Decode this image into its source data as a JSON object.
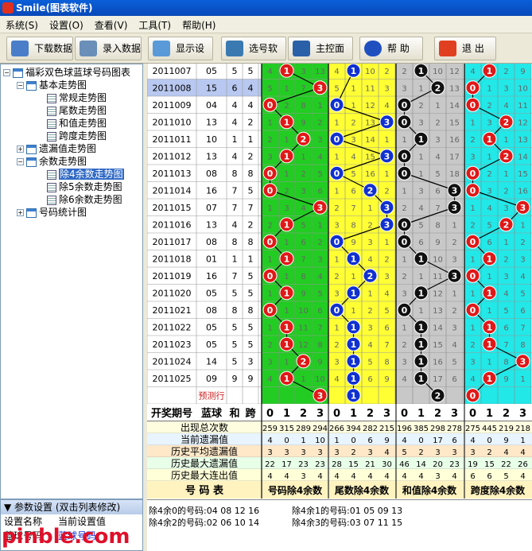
{
  "window": {
    "title": "Smile(图表软件)"
  },
  "menu": [
    "系统(S)",
    "设置(O)",
    "查看(V)",
    "工具(T)",
    "帮助(H)"
  ],
  "toolbar": {
    "download": "下载数据",
    "input": "录入数据",
    "display": "显示设置",
    "select": "选号软件",
    "panel": "主控面板",
    "help": "帮 助",
    "exit": "退 出"
  },
  "tree": {
    "root": "福彩双色球蓝球号码图表",
    "basic": "基本走势图",
    "normal": "常规走势图",
    "tail": "尾数走势图",
    "sum": "和值走势图",
    "span": "跨度走势图",
    "miss": "遗漏值走势图",
    "rem": "余数走势图",
    "mod4": "除4余数走势图",
    "mod5": "除5余数走势图",
    "mod6": "除6余数走势图",
    "stat": "号码统计图"
  },
  "params": {
    "header": "参数设置 (双击列表修改)",
    "col_name": "设置名称",
    "col_value": "当前设置值",
    "row_name": "蓝球号码",
    "row_value": "蓝球号码"
  },
  "watermark": "pinble.com",
  "rows": [
    {
      "p": "2011007",
      "n": "05",
      "t": "5",
      "s": "5",
      "a": [
        4,
        "@1",
        3,
        13
      ],
      "b": [
        4,
        "@1",
        10,
        2
      ],
      "c": [
        2,
        "@1",
        10,
        12
      ],
      "d": [
        4,
        "@1",
        2,
        9
      ]
    },
    {
      "p": "2011008",
      "n": "15",
      "t": "6",
      "s": "4",
      "a": [
        5,
        1,
        7,
        "@3"
      ],
      "b": [
        5,
        1,
        11,
        3
      ],
      "c": [
        3,
        1,
        "@2",
        13
      ],
      "d": [
        "@0",
        1,
        3,
        10
      ]
    },
    {
      "p": "2011009",
      "n": "04",
      "t": "4",
      "s": "4",
      "a": [
        "@0",
        2,
        8,
        1
      ],
      "b": [
        "@0",
        1,
        12,
        4
      ],
      "c": [
        "@0",
        2,
        1,
        14
      ],
      "d": [
        "@0",
        2,
        4,
        11
      ]
    },
    {
      "p": "2011010",
      "n": "13",
      "t": "4",
      "s": "2",
      "a": [
        1,
        "@1",
        9,
        2
      ],
      "b": [
        1,
        2,
        13,
        "@3"
      ],
      "c": [
        "@0",
        3,
        2,
        15
      ],
      "d": [
        1,
        3,
        "@2",
        12
      ]
    },
    {
      "p": "2011011",
      "n": "10",
      "t": "1",
      "s": "1",
      "a": [
        2,
        1,
        "@2",
        3
      ],
      "b": [
        "@0",
        3,
        14,
        1
      ],
      "c": [
        1,
        "@1",
        3,
        16
      ],
      "d": [
        2,
        "@1",
        1,
        13
      ]
    },
    {
      "p": "2011012",
      "n": "13",
      "t": "4",
      "s": "2",
      "a": [
        3,
        "@1",
        1,
        4
      ],
      "b": [
        1,
        4,
        15,
        "@3"
      ],
      "c": [
        "@0",
        1,
        4,
        17
      ],
      "d": [
        3,
        1,
        "@2",
        14
      ]
    },
    {
      "p": "2011013",
      "n": "08",
      "t": "8",
      "s": "8",
      "a": [
        "@0",
        1,
        2,
        5
      ],
      "b": [
        "@0",
        5,
        16,
        1
      ],
      "c": [
        "@0",
        1,
        5,
        18
      ],
      "d": [
        "@0",
        2,
        1,
        15
      ]
    },
    {
      "p": "2011014",
      "n": "16",
      "t": "7",
      "s": "5",
      "a": [
        "@0",
        2,
        3,
        6
      ],
      "b": [
        1,
        6,
        "@2",
        2
      ],
      "c": [
        1,
        3,
        6,
        "@3"
      ],
      "d": [
        "@0",
        3,
        2,
        16
      ]
    },
    {
      "p": "2011015",
      "n": "07",
      "t": "7",
      "s": "7",
      "a": [
        1,
        3,
        4,
        "@3"
      ],
      "b": [
        2,
        7,
        1,
        "@3"
      ],
      "c": [
        2,
        4,
        7,
        "@3"
      ],
      "d": [
        1,
        4,
        3,
        "@3"
      ]
    },
    {
      "p": "2011016",
      "n": "13",
      "t": "4",
      "s": "2",
      "a": [
        2,
        "@1",
        5,
        1
      ],
      "b": [
        3,
        8,
        2,
        "@3"
      ],
      "c": [
        "@0",
        5,
        8,
        1
      ],
      "d": [
        2,
        5,
        "@2",
        1
      ]
    },
    {
      "p": "2011017",
      "n": "08",
      "t": "8",
      "s": "8",
      "a": [
        "@0",
        1,
        6,
        2
      ],
      "b": [
        "@0",
        9,
        3,
        1
      ],
      "c": [
        "@0",
        6,
        9,
        2
      ],
      "d": [
        "@0",
        6,
        1,
        2
      ]
    },
    {
      "p": "2011018",
      "n": "01",
      "t": "1",
      "s": "1",
      "a": [
        1,
        "@1",
        7,
        3
      ],
      "b": [
        1,
        "@1",
        4,
        2
      ],
      "c": [
        1,
        "@1",
        10,
        3
      ],
      "d": [
        1,
        "@1",
        2,
        3
      ]
    },
    {
      "p": "2011019",
      "n": "16",
      "t": "7",
      "s": "5",
      "a": [
        "@0",
        1,
        8,
        4
      ],
      "b": [
        2,
        1,
        "@2",
        3
      ],
      "c": [
        2,
        1,
        11,
        "@3"
      ],
      "d": [
        "@0",
        1,
        3,
        4
      ]
    },
    {
      "p": "2011020",
      "n": "05",
      "t": "5",
      "s": "5",
      "a": [
        1,
        "@1",
        9,
        5
      ],
      "b": [
        3,
        "@1",
        1,
        4
      ],
      "c": [
        3,
        "@1",
        12,
        1
      ],
      "d": [
        1,
        "@1",
        4,
        5
      ]
    },
    {
      "p": "2011021",
      "n": "08",
      "t": "8",
      "s": "8",
      "a": [
        "@0",
        1,
        10,
        6
      ],
      "b": [
        "@0",
        1,
        2,
        5
      ],
      "c": [
        "@0",
        1,
        13,
        2
      ],
      "d": [
        "@0",
        1,
        5,
        6
      ]
    },
    {
      "p": "2011022",
      "n": "05",
      "t": "5",
      "s": "5",
      "a": [
        1,
        "@1",
        11,
        7
      ],
      "b": [
        1,
        "@1",
        3,
        6
      ],
      "c": [
        1,
        "@1",
        14,
        3
      ],
      "d": [
        1,
        "@1",
        6,
        7
      ]
    },
    {
      "p": "2011023",
      "n": "05",
      "t": "5",
      "s": "5",
      "a": [
        2,
        "@1",
        12,
        8
      ],
      "b": [
        2,
        "@1",
        4,
        7
      ],
      "c": [
        2,
        "@1",
        15,
        4
      ],
      "d": [
        2,
        "@1",
        7,
        8
      ]
    },
    {
      "p": "2011024",
      "n": "14",
      "t": "5",
      "s": "3",
      "a": [
        3,
        1,
        "@2",
        9
      ],
      "b": [
        3,
        "@1",
        5,
        8
      ],
      "c": [
        3,
        "@1",
        16,
        5
      ],
      "d": [
        3,
        1,
        8,
        "@3"
      ]
    },
    {
      "p": "2011025",
      "n": "09",
      "t": "9",
      "s": "9",
      "a": [
        4,
        "@1",
        1,
        10
      ],
      "b": [
        4,
        "@1",
        6,
        9
      ],
      "c": [
        4,
        "@1",
        17,
        6
      ],
      "d": [
        4,
        "@1",
        9,
        1
      ]
    }
  ],
  "predict": {
    "label": "预测行",
    "a": 3,
    "b": 1,
    "c": 2,
    "d": 0
  },
  "header": {
    "period": "开奖期号",
    "blue": "蓝球",
    "he": "和",
    "kua": "跨",
    "digits": [
      "0",
      "1",
      "2",
      "3"
    ]
  },
  "stats": [
    {
      "label": "出现总次数",
      "v": [
        259,
        315,
        289,
        294,
        266,
        394,
        282,
        215,
        196,
        385,
        298,
        278,
        275,
        445,
        219,
        218
      ]
    },
    {
      "label": "当前遗漏值",
      "v": [
        4,
        0,
        1,
        10,
        1,
        0,
        6,
        9,
        4,
        0,
        17,
        6,
        4,
        0,
        9,
        1
      ]
    },
    {
      "label": "历史平均遗漏值",
      "v": [
        3,
        3,
        3,
        3,
        3,
        2,
        3,
        4,
        5,
        2,
        3,
        3,
        3,
        2,
        4,
        4
      ]
    },
    {
      "label": "历史最大遗漏值",
      "v": [
        22,
        17,
        23,
        23,
        28,
        15,
        21,
        30,
        46,
        14,
        20,
        23,
        19,
        15,
        22,
        26
      ]
    },
    {
      "label": "历史最大连出值",
      "v": [
        4,
        4,
        3,
        4,
        4,
        4,
        4,
        4,
        4,
        4,
        3,
        4,
        6,
        6,
        5,
        4
      ]
    }
  ],
  "footer": {
    "title": "号 码 表",
    "g1": "号码除4余数",
    "g2": "尾数除4余数",
    "g3": "和值除4余数",
    "g4": "跨度除4余数"
  },
  "info": {
    "r0": "除4余0的号码:04 08 12 16",
    "r1": "除4余1的号码:01 05 09 13",
    "r2": "除4余2的号码:02 06 10 14",
    "r3": "除4余3的号码:03 07 11 15"
  },
  "colors": {
    "green": "#22cc22",
    "yellow": "#ffff33",
    "gray": "#c8c8c8",
    "cyan": "#22e8e8",
    "red": "#e01818",
    "blue": "#1030d0",
    "black": "#101010"
  }
}
